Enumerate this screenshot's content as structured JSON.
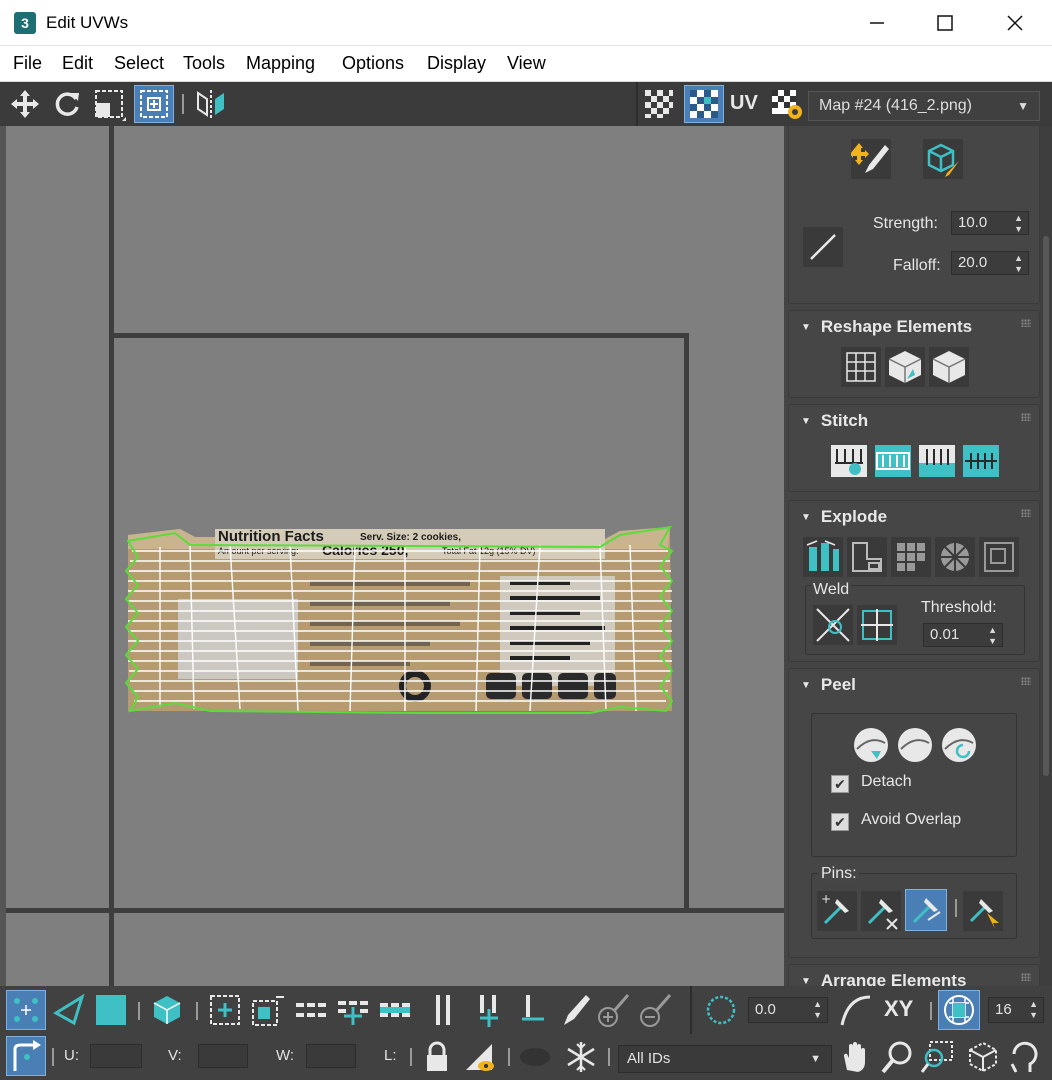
{
  "window": {
    "title": "Edit UVWs",
    "app_icon": "3"
  },
  "menu": [
    "File",
    "Edit",
    "Select",
    "Tools",
    "Mapping",
    "Options",
    "Display",
    "View"
  ],
  "toolbar": {
    "uv_label": "UV",
    "map_dropdown": "Map #24 (416_2.png)"
  },
  "soft_select": {
    "strength_label": "Strength:",
    "strength_value": "10.0",
    "falloff_label": "Falloff:",
    "falloff_value": "20.0"
  },
  "reshape": {
    "title": "Reshape Elements"
  },
  "stitch": {
    "title": "Stitch"
  },
  "explode": {
    "title": "Explode",
    "weld_label": "Weld",
    "threshold_label": "Threshold:",
    "threshold_value": "0.01"
  },
  "peel": {
    "title": "Peel",
    "detach_label": "Detach",
    "avoid_overlap_label": "Avoid Overlap",
    "pins_label": "Pins:"
  },
  "arrange": {
    "title": "Arrange Elements"
  },
  "bottom": {
    "rotate_value": "0.0",
    "xy_label": "XY",
    "grid_value": "16",
    "u_label": "U:",
    "v_label": "V:",
    "w_label": "W:",
    "l_label": "L:",
    "ids_select": "All IDs"
  },
  "texture": {
    "title_text": "Nutrition Facts",
    "serving_text": "Serv. Size: 2 cookies,",
    "amount_text": "Amount per serving:",
    "calories_text": "Calories 250,",
    "fat_text": "Total Fat 12g (15% DV)"
  },
  "colors": {
    "accent": "#3ec0c4",
    "wire": "#ffffff",
    "edge": "#5adc3a",
    "viewport": "#7f7f7f"
  }
}
